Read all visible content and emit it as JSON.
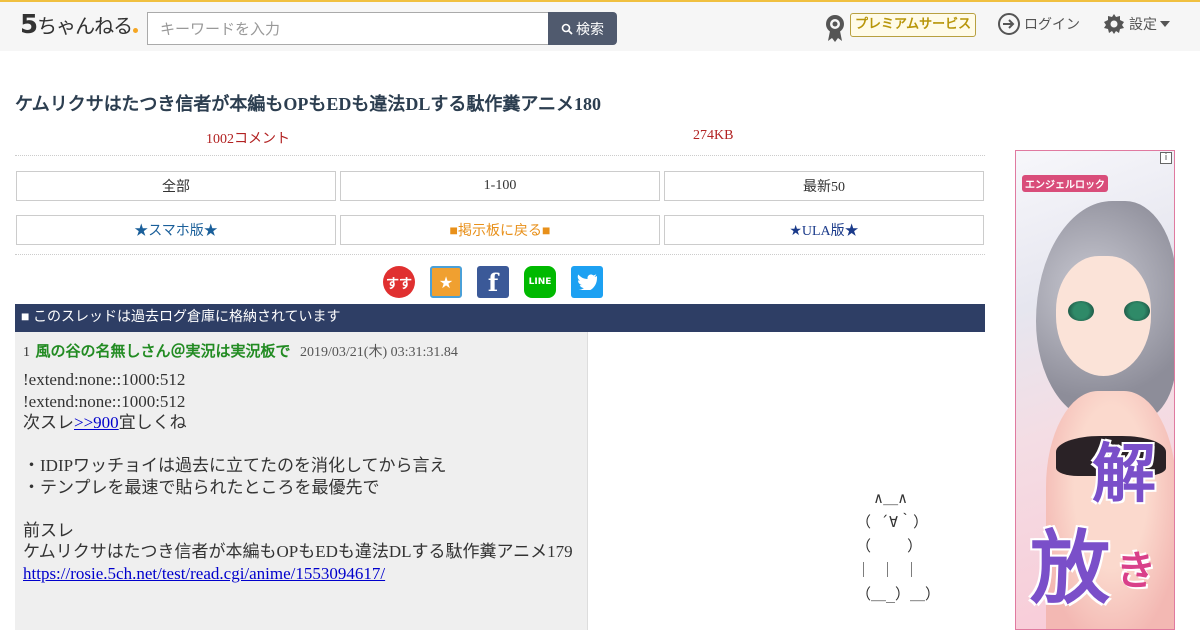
{
  "header": {
    "logo_main": "5",
    "logo_sub": "ちゃんねる",
    "search_placeholder": "キーワードを入力",
    "search_button": "検索",
    "premium_label": "プレミアムサービス",
    "login_label": "ログイン",
    "settings_label": "設定"
  },
  "thread": {
    "title": "ケムリクサはたつき信者が本編もOPもEDも違法DLする駄作糞アニメ180",
    "comment_count": "1002コメント",
    "size": "274KB"
  },
  "nav_row1": [
    "全部",
    "1-100",
    "最新50"
  ],
  "nav_row2": {
    "smartphone": "★スマホ版★",
    "back_to_board": "■掲示板に戻る■",
    "ula": "★ULA版★"
  },
  "colors": {
    "smartphone": "#1a5f9a",
    "back_to_board": "#e8901a",
    "ula": "#1a3a8a",
    "notice_bg": "#2e3e65"
  },
  "share": [
    {
      "icon": "sukusuku-icon",
      "glyph": "すす",
      "color": "#e03030"
    },
    {
      "icon": "bookmark-icon",
      "glyph": "★",
      "color": "#f0a030"
    },
    {
      "icon": "facebook-icon",
      "glyph": "f",
      "color": "#3b5998"
    },
    {
      "icon": "line-icon",
      "glyph": "LINE",
      "color": "#00b900"
    },
    {
      "icon": "twitter-icon",
      "glyph": "🐦",
      "color": "#1da1f2"
    }
  ],
  "notice": "■ このスレッドは過去ログ倉庫に格納されています",
  "post": {
    "number": "1",
    "name": "風の谷の名無しさん＠実況は実況板で",
    "date": "2019/03/21(木) 03:31:31.84",
    "line1": "!extend:none::1000:512",
    "line2": "!extend:none::1000:512",
    "line3_pre": "次スレ",
    "line3_link": ">>900",
    "line3_post": "宜しくね",
    "line4": "・IDIPワッチョイは過去に立てたのを消化してから言え",
    "line5": "・テンプレを最速で貼られたところを最優先で",
    "line6": "前スレ",
    "line7": "ケムリクサはたつき信者が本編もOPもEDも違法DLする駄作糞アニメ179",
    "line8_link": "https://rosie.5ch.net/test/read.cgi/anime/1553094617/"
  },
  "ascii_art": "  ∧＿∧\n（ ´∀｀）\n（    ）\n｜ ｜ ｜\n（＿_）＿）",
  "ad": {
    "logo_text": "エンジェルロック",
    "info": "i",
    "text_big1": "解",
    "text_big2": "放",
    "text_small": "き"
  }
}
